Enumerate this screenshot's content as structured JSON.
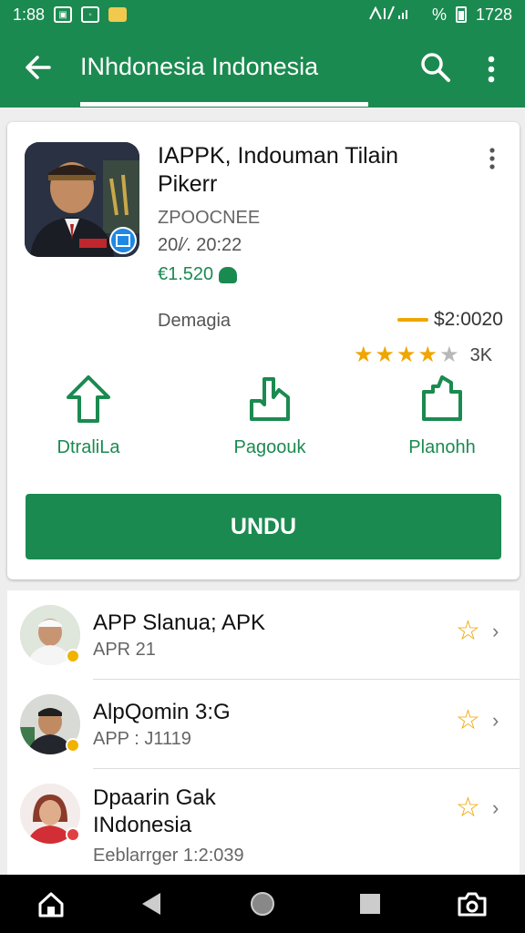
{
  "status_bar": {
    "time": "1:88",
    "right_text": "% ",
    "clock": "1728"
  },
  "app_bar": {
    "title": "INhdonesia Indonesia"
  },
  "app": {
    "title": "IAPPK, Indouman Tilain Pikerr",
    "developer": "ZPOOCNEE",
    "date": "20/⁄. 20:22",
    "downloads": "€1.520",
    "category": "Demagia",
    "price": "$2:0020",
    "rating": 4,
    "rating_max": 5,
    "rating_count": "3K",
    "actions": [
      {
        "label": "DtraliLa",
        "icon": "arrow-up-icon"
      },
      {
        "label": "Pagoouk",
        "icon": "download-tray-icon"
      },
      {
        "label": "Planohh",
        "icon": "share-tray-icon"
      }
    ],
    "install_label": "UNDU"
  },
  "list": [
    {
      "title": "APP Slanua; APK",
      "subtitle": "APR         21"
    },
    {
      "title": "AlpQomin 3:G",
      "subtitle": "APP : J1119"
    },
    {
      "title": "Dpaarin Gak",
      "title2": "INdonesia",
      "subtitle": "Eeblarrger 1:2:039"
    }
  ],
  "colors": {
    "primary": "#1b8a50",
    "accent": "#f0a500"
  }
}
